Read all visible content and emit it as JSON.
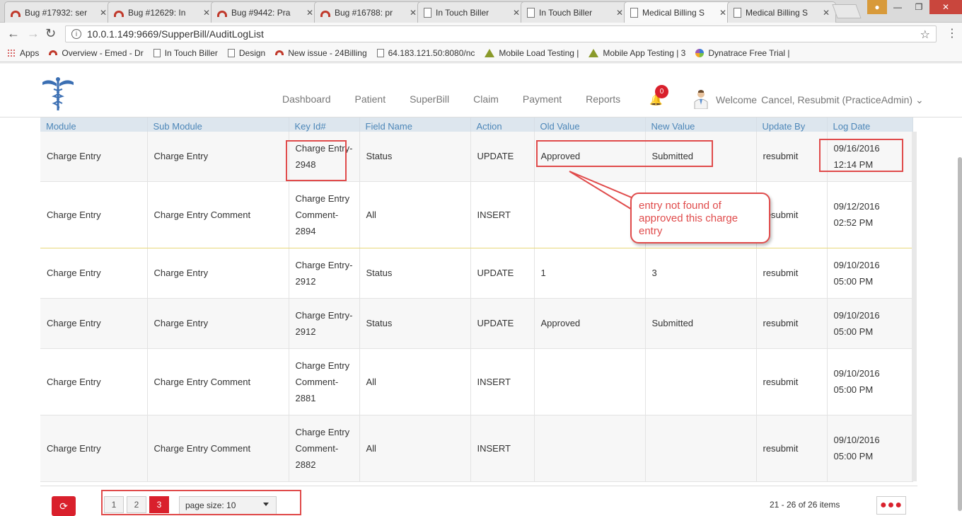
{
  "browser": {
    "tabs": [
      {
        "label": "Bug #17932: ser",
        "icon": "bug-icon"
      },
      {
        "label": "Bug #12629: In",
        "icon": "bug-icon"
      },
      {
        "label": "Bug #9442: Pra",
        "icon": "bug-icon"
      },
      {
        "label": "Bug #16788: pr",
        "icon": "bug-icon"
      },
      {
        "label": "In Touch Biller",
        "icon": "document-icon"
      },
      {
        "label": "In Touch Biller",
        "icon": "document-icon"
      },
      {
        "label": "Medical Billing S",
        "icon": "document-icon",
        "active": true
      },
      {
        "label": "Medical Billing S",
        "icon": "document-icon"
      }
    ],
    "address": "10.0.1.149:9669/SupperBill/AuditLogList",
    "bookmarks": [
      {
        "label": "Apps",
        "icon": "apps-icon"
      },
      {
        "label": "Overview - Emed - Dr",
        "icon": "bug-icon"
      },
      {
        "label": "In Touch Biller",
        "icon": "document-icon"
      },
      {
        "label": "Design",
        "icon": "document-icon"
      },
      {
        "label": "New issue - 24Billing",
        "icon": "bug-icon"
      },
      {
        "label": "64.183.121.50:8080/nc",
        "icon": "document-icon"
      },
      {
        "label": "Mobile Load Testing |",
        "icon": "triangle-icon"
      },
      {
        "label": "Mobile App Testing | 3",
        "icon": "triangle-icon"
      },
      {
        "label": "Dynatrace Free Trial |",
        "icon": "dynatrace-icon"
      }
    ]
  },
  "header": {
    "nav": [
      "Dashboard",
      "Patient",
      "SuperBill",
      "Claim",
      "Payment",
      "Reports"
    ],
    "notification_count": "0",
    "welcome_label": "Welcome",
    "user_name": "Cancel, Resubmit (PracticeAdmin)"
  },
  "table": {
    "columns": [
      "Module",
      "Sub Module",
      "Key Id#",
      "Field Name",
      "Action",
      "Old Value",
      "New Value",
      "Update By",
      "Log Date"
    ],
    "rows": [
      {
        "module": "Charge Entry",
        "sub_module": "Charge Entry",
        "key_id": "Charge Entry-\n2948",
        "field": "Status",
        "action": "UPDATE",
        "old": "Approved",
        "new": "Submitted",
        "by": "resubmit",
        "date": "09/16/2016\n12:14 PM"
      },
      {
        "module": "Charge Entry",
        "sub_module": "Charge Entry Comment",
        "key_id": "Charge Entry\nComment-\n2894",
        "field": "All",
        "action": "INSERT",
        "old": "",
        "new": "",
        "by": "resubmit",
        "date": "09/12/2016\n02:52 PM"
      },
      {
        "module": "Charge Entry",
        "sub_module": "Charge Entry",
        "key_id": "Charge Entry-\n2912",
        "field": "Status",
        "action": "UPDATE",
        "old": "1",
        "new": "3",
        "by": "resubmit",
        "date": "09/10/2016\n05:00 PM"
      },
      {
        "module": "Charge Entry",
        "sub_module": "Charge Entry",
        "key_id": "Charge Entry-\n2912",
        "field": "Status",
        "action": "UPDATE",
        "old": "Approved",
        "new": "Submitted",
        "by": "resubmit",
        "date": "09/10/2016\n05:00 PM"
      },
      {
        "module": "Charge Entry",
        "sub_module": "Charge Entry Comment",
        "key_id": "Charge Entry\nComment-\n2881",
        "field": "All",
        "action": "INSERT",
        "old": "",
        "new": "",
        "by": "resubmit",
        "date": "09/10/2016\n05:00 PM"
      },
      {
        "module": "Charge Entry",
        "sub_module": "Charge Entry Comment",
        "key_id": "Charge Entry\nComment-\n2882",
        "field": "All",
        "action": "INSERT",
        "old": "",
        "new": "",
        "by": "resubmit",
        "date": "09/10/2016\n05:00 PM"
      }
    ]
  },
  "footer": {
    "pages": [
      "1",
      "2",
      "3"
    ],
    "current_page": "3",
    "page_size_label": "page size: 10",
    "item_info": "21 - 26 of 26 items"
  },
  "annotation": {
    "callout_text": "entry not found of approved this charge entry"
  },
  "colors": {
    "accent": "#d9202c",
    "header_text": "#4c86b8",
    "annotation": "#e04b4b"
  }
}
